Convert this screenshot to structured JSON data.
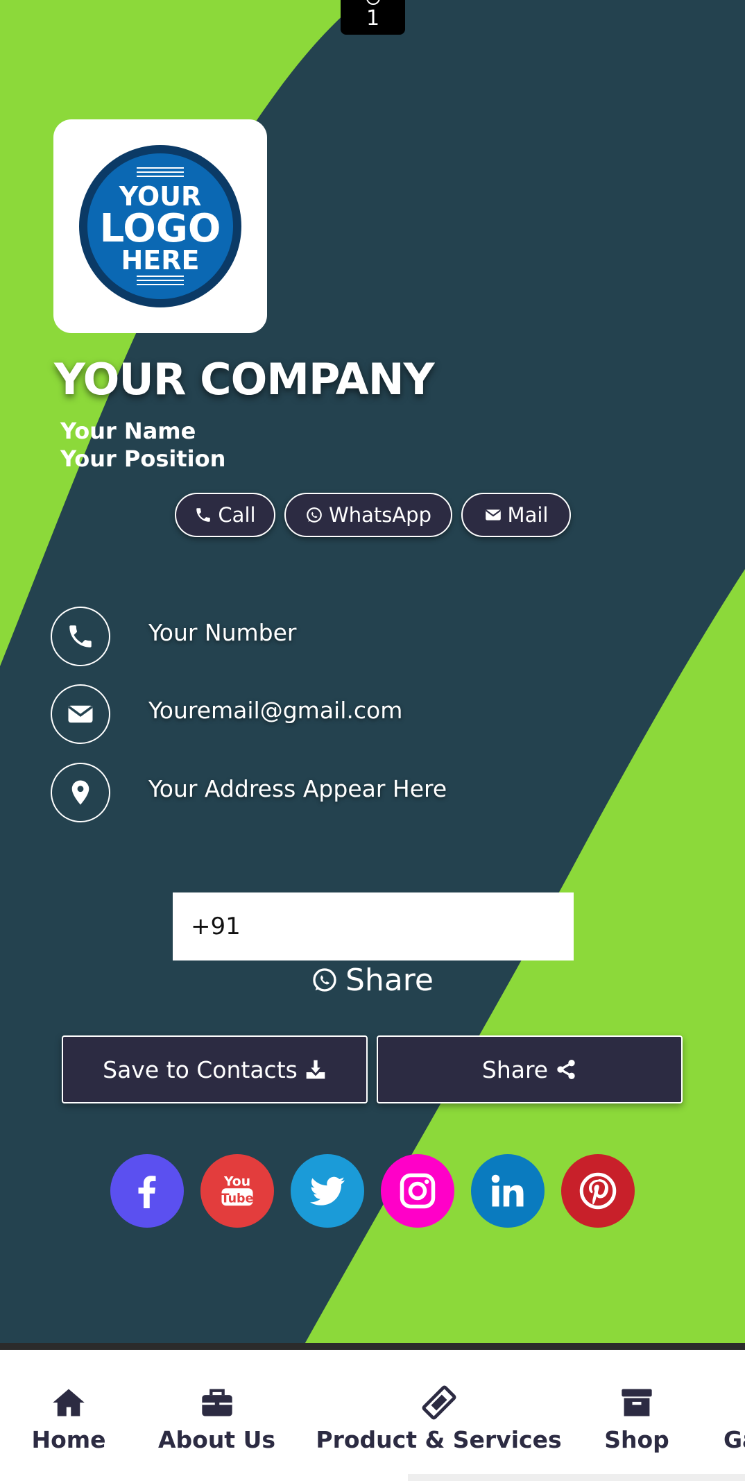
{
  "colors": {
    "green": "#8cd93a",
    "dark_teal": "#24424f",
    "button_dark": "#2c2b42",
    "logo_blue": "#0b68b3",
    "logo_navy": "#0b3a66",
    "facebook": "#5b50f0",
    "youtube": "#e33d3d",
    "twitter": "#1b9bd8",
    "instagram": "#ff00c8",
    "linkedin": "#0a7bbf",
    "pinterest": "#c8202a"
  },
  "view_counter": {
    "count": "1",
    "icon": "eye-icon"
  },
  "logo": {
    "line1": "YOUR",
    "line2": "LOGO",
    "line3": "HERE"
  },
  "profile": {
    "company": "YOUR COMPANY",
    "name": "Your Name",
    "position": "Your Position"
  },
  "quick_actions": [
    {
      "label": "Call",
      "icon": "phone-icon"
    },
    {
      "label": "WhatsApp",
      "icon": "whatsapp-icon"
    },
    {
      "label": "Mail",
      "icon": "envelope-icon"
    }
  ],
  "contact_info": [
    {
      "text": "Your Number",
      "icon": "phone-icon"
    },
    {
      "text": "Youremail@gmail.com",
      "icon": "envelope-icon"
    },
    {
      "text": "Your Address Appear Here",
      "icon": "map-marker-icon"
    }
  ],
  "whatsapp_share": {
    "input_value": "+91",
    "label": "Share",
    "icon": "whatsapp-icon"
  },
  "actions": {
    "save_label": "Save to Contacts",
    "save_icon": "download-icon",
    "share_label": "Share",
    "share_icon": "share-icon"
  },
  "social": [
    "facebook",
    "youtube",
    "twitter",
    "instagram",
    "linkedin",
    "pinterest"
  ],
  "youtube_label": {
    "you": "You",
    "tube": "Tube"
  },
  "nav": [
    {
      "label": "Home",
      "icon": "home-icon"
    },
    {
      "label": "About Us",
      "icon": "briefcase-icon"
    },
    {
      "label": "Product & Services",
      "icon": "ticket-icon"
    },
    {
      "label": "Shop",
      "icon": "archive-box-icon"
    },
    {
      "label": "Ga",
      "icon": ""
    }
  ]
}
